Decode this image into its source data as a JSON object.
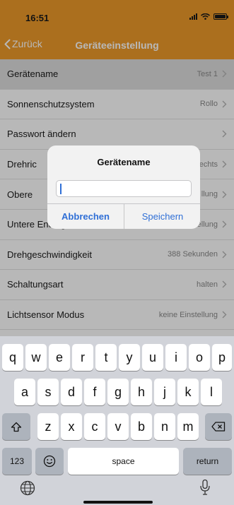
{
  "status": {
    "time": "16:51"
  },
  "nav": {
    "back_label": "Zurück",
    "title": "Geräteeinstellung"
  },
  "settings": [
    {
      "label": "Gerätename",
      "value": "Test 1"
    },
    {
      "label": "Sonnenschutzsystem",
      "value": "Rollo"
    },
    {
      "label": "Passwort ändern",
      "value": ""
    },
    {
      "label": "Drehric",
      "value": "echts"
    },
    {
      "label": "Obere",
      "value": "llung"
    },
    {
      "label": "Untere Endlage",
      "value": "keine Einstellung"
    },
    {
      "label": "Drehgeschwindigkeit",
      "value": "388 Sekunden"
    },
    {
      "label": "Schaltungsart",
      "value": "halten"
    },
    {
      "label": "Lichtsensor Modus",
      "value": "keine Einstellung"
    }
  ],
  "alert": {
    "title": "Gerätename",
    "input_value": "",
    "cancel_label": "Abbrechen",
    "save_label": "Speichern"
  },
  "keyboard": {
    "row1": [
      "q",
      "w",
      "e",
      "r",
      "t",
      "y",
      "u",
      "i",
      "o",
      "p"
    ],
    "row2": [
      "a",
      "s",
      "d",
      "f",
      "g",
      "h",
      "j",
      "k",
      "l"
    ],
    "row3": [
      "z",
      "x",
      "c",
      "v",
      "b",
      "n",
      "m"
    ],
    "numbers_label": "123",
    "space_label": "space",
    "return_label": "return"
  },
  "colors": {
    "accent": "#ee9a2a",
    "link": "#2f6fd6"
  }
}
